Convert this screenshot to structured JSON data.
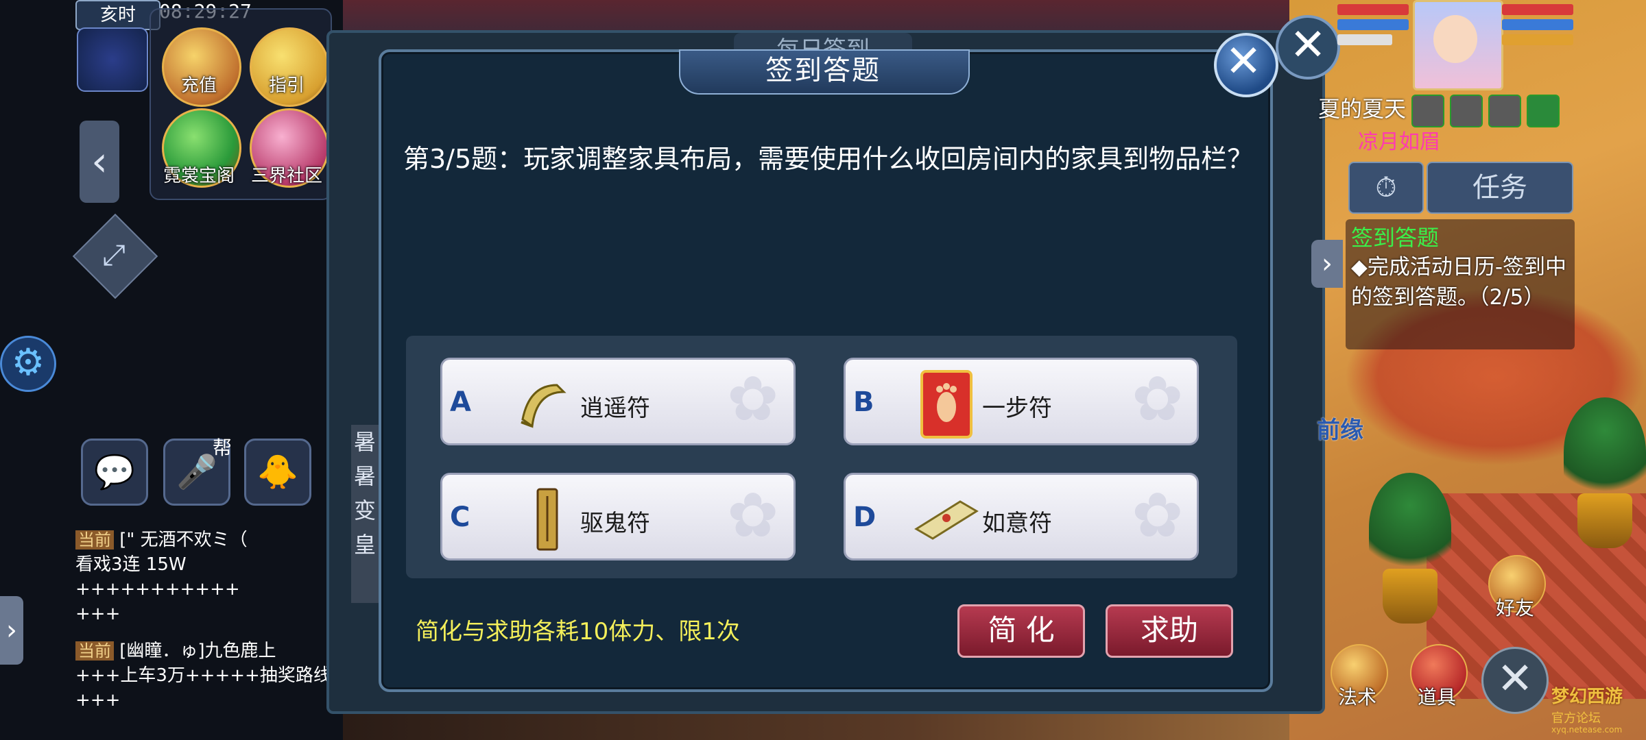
{
  "hud_top_left": {
    "time_period": "亥时",
    "clock": "08:29:27",
    "buttons": [
      {
        "label": "充值"
      },
      {
        "label": "指引"
      },
      {
        "label": "霓裳宝阁"
      },
      {
        "label": "三界社区"
      }
    ],
    "help_badge": "帮"
  },
  "chat": {
    "lines": [
      {
        "tag": "当前",
        "text": "[\" 无酒不欢ミ（",
        "cont": "看戏3连  15W +++++++++++",
        "cont2": "+++"
      },
      {
        "tag": "当前",
        "text": "[幽瞳．ゅ]九色鹿上",
        "cont": "+++上车3万+++++抽奖路线",
        "cont2": "+++"
      }
    ]
  },
  "back_panel": {
    "title": "每日签到",
    "side_items": [
      "暑",
      "暑",
      "变",
      "皇"
    ]
  },
  "dialog": {
    "title": "签到答题",
    "question": "第3/5题：玩家调整家具布局，需要使用什么收回房间内的家具到物品栏？",
    "options": [
      {
        "letter": "A",
        "label": "逍遥符",
        "icon": "scroll-icon"
      },
      {
        "letter": "B",
        "label": "一步符",
        "icon": "footprint-card-icon"
      },
      {
        "letter": "C",
        "label": "驱鬼符",
        "icon": "talisman-icon"
      },
      {
        "letter": "D",
        "label": "如意符",
        "icon": "open-scroll-icon"
      }
    ],
    "hint": "简化与求助各耗10体力、限1次",
    "simplify_label": "简 化",
    "help_label": "求助"
  },
  "hud_right": {
    "player_name": "夏的夏天",
    "sub_name": "凉月如眉",
    "task_button": "任务",
    "task_title": "签到答题",
    "task_desc": "◆完成活动日历-签到中的签到答题。（2/5）",
    "fate_text": "前缘",
    "friends_label": "好友",
    "magic_label": "法术",
    "items_label": "道具"
  },
  "watermark": {
    "logo": "梦幻西游",
    "sub": "官方论坛",
    "url": "xyq.netease.com"
  },
  "colors": {
    "dialog_bg": "#13283a",
    "option_letter": "#1e4a9a",
    "hint": "#f4ef5a",
    "action_button": "#9a2a3e",
    "task_title": "#3af04a",
    "sub_name": "#ff3ab0"
  }
}
